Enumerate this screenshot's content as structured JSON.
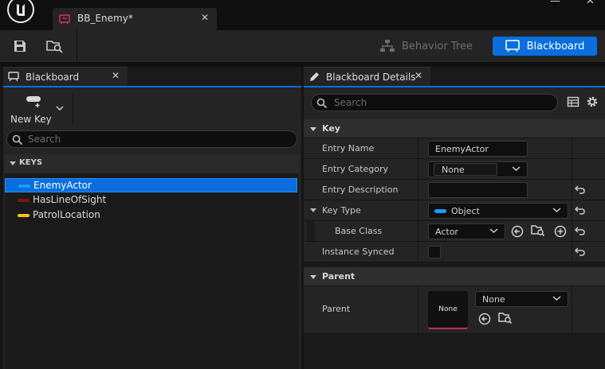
{
  "document_tab": {
    "title": "BB_Enemy*",
    "close": "✕"
  },
  "window": {
    "minimize": "—",
    "close": "✕"
  },
  "toolbar": {
    "behavior_tree": "Behavior Tree",
    "blackboard": "Blackboard"
  },
  "left_panel": {
    "tab_title": "Blackboard",
    "close": "✕",
    "new_key": "New Key",
    "search_placeholder": "Search",
    "keys_header": "KEYS",
    "keys": [
      {
        "label": "EnemyActor",
        "color": "#1e9bf0",
        "selected": true
      },
      {
        "label": "HasLineOfSight",
        "color": "#8a0f0f",
        "selected": false
      },
      {
        "label": "PatrolLocation",
        "color": "#f0c419",
        "selected": false
      }
    ]
  },
  "right_panel": {
    "tab_title": "Blackboard Details",
    "close": "✕",
    "search_placeholder": "Search",
    "sections": {
      "key": "Key",
      "parent": "Parent"
    },
    "props": {
      "entry_name": {
        "label": "Entry Name",
        "value": "EnemyActor"
      },
      "entry_category": {
        "label": "Entry Category",
        "value": "None"
      },
      "entry_description": {
        "label": "Entry Description",
        "value": ""
      },
      "key_type": {
        "label": "Key Type",
        "value": "Object"
      },
      "base_class": {
        "label": "Base Class",
        "value": "Actor"
      },
      "instance_synced": {
        "label": "Instance Synced",
        "checked": false
      },
      "parent": {
        "label": "Parent",
        "thumbnail": "None",
        "value": "None"
      }
    }
  },
  "colors": {
    "accent": "#0a6ede",
    "object_type": "#1e9bf0",
    "parent_underline": "#c0305a"
  }
}
